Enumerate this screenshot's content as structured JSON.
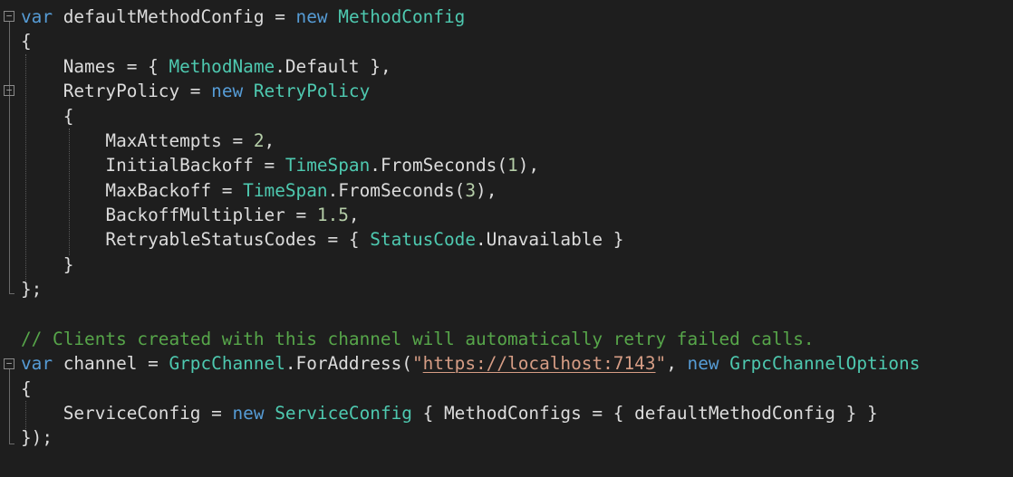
{
  "code": {
    "l1": {
      "kw1": "var",
      "t1": " defaultMethodConfig = ",
      "kw2": "new",
      "t2": " ",
      "ty1": "MethodConfig"
    },
    "l2": {
      "t1": "{"
    },
    "l3": {
      "t1": "    Names = { ",
      "ty1": "MethodName",
      "t2": ".Default },",
      "t3": ""
    },
    "l4": {
      "t1": "    RetryPolicy = ",
      "kw1": "new",
      "t2": " ",
      "ty1": "RetryPolicy"
    },
    "l5": {
      "t1": "    {"
    },
    "l6": {
      "t1": "        MaxAttempts = ",
      "nu1": "2",
      "t2": ","
    },
    "l7": {
      "t1": "        InitialBackoff = ",
      "ty1": "TimeSpan",
      "t2": ".FromSeconds(",
      "nu1": "1",
      "t3": "),"
    },
    "l8": {
      "t1": "        MaxBackoff = ",
      "ty1": "TimeSpan",
      "t2": ".FromSeconds(",
      "nu1": "3",
      "t3": "),"
    },
    "l9": {
      "t1": "        BackoffMultiplier = ",
      "nu1": "1.5",
      "t2": ","
    },
    "l10": {
      "t1": "        RetryableStatusCodes = { ",
      "ty1": "StatusCode",
      "t2": ".Unavailable }"
    },
    "l11": {
      "t1": "    }"
    },
    "l12": {
      "t1": "};"
    },
    "l14": {
      "cm1": "// Clients created with this channel will automatically retry failed calls."
    },
    "l15": {
      "kw1": "var",
      "t1": " channel = ",
      "ty1": "GrpcChannel",
      "t2": ".ForAddress(",
      "st1": "\"",
      "url": "https://localhost:7143",
      "st2": "\"",
      "t3": ", ",
      "kw2": "new",
      "t4": " ",
      "ty2": "GrpcChannelOptions"
    },
    "l16": {
      "t1": "{"
    },
    "l17": {
      "t1": "    ServiceConfig = ",
      "kw1": "new",
      "t2": " ",
      "ty1": "ServiceConfig",
      "t3": " { MethodConfigs = { defaultMethodConfig } }"
    },
    "l18": {
      "t1": "});"
    }
  },
  "colors": {
    "background": "#1e1e1e",
    "default_text": "#dcdcdc",
    "keyword": "#569cd6",
    "type": "#4ec9b0",
    "number": "#b5cea8",
    "comment": "#57a64a",
    "string": "#d69d85"
  },
  "icons": {
    "fold_marker": "collapse-minus-icon"
  }
}
